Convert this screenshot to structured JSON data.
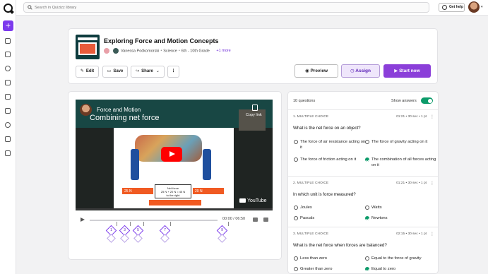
{
  "search": {
    "placeholder": "Search in Quizizz library"
  },
  "topbar": {
    "help_label": "Get help"
  },
  "quiz": {
    "title": "Exploring Force and Motion Concepts",
    "author": "Vanessa Podkomorski",
    "subject": "Science",
    "grade": "6th - 10th Grade",
    "more": "+1 more"
  },
  "actions": {
    "edit": "Edit",
    "save": "Save",
    "share": "Share",
    "more": "⋮",
    "preview": "Preview",
    "assign": "Assign",
    "start": "Start now"
  },
  "video": {
    "title": "Force and Motion",
    "subtitle": "Combining net force",
    "copy_link": "Copy link",
    "left_force": "25 N",
    "right_force": "20 N",
    "net_force_text": "Net force\n25 N + 20 N = 45 N\nto the right",
    "yt_label": "YouTube",
    "time": "00:00 / 06:50"
  },
  "video_markers": [
    "1",
    "3",
    "5",
    "7",
    "9"
  ],
  "panel": {
    "count": "10 questions",
    "show_answers": "Show answers",
    "show_answers_on": true
  },
  "questions": [
    {
      "type": "1. MULTIPLE CHOICE",
      "time": "01:21",
      "sec": "30 sec",
      "pts": "1 pt",
      "text": "What is the net force on an object?",
      "options": [
        {
          "label": "The force of air resistance acting on it",
          "correct": false
        },
        {
          "label": "The force of gravity acting on it",
          "correct": false
        },
        {
          "label": "The force of friction acting on it",
          "correct": false
        },
        {
          "label": "The combination of all forces acting on it",
          "correct": true
        }
      ]
    },
    {
      "type": "2. MULTIPLE CHOICE",
      "time": "01:21",
      "sec": "30 sec",
      "pts": "1 pt",
      "text": "In which unit is force measured?",
      "options": [
        {
          "label": "Joules",
          "correct": false
        },
        {
          "label": "Watts",
          "correct": false
        },
        {
          "label": "Pascals",
          "correct": false
        },
        {
          "label": "Newtons",
          "correct": true
        }
      ]
    },
    {
      "type": "3. MULTIPLE CHOICE",
      "time": "02:15",
      "sec": "30 sec",
      "pts": "1 pt",
      "text": "What is the net force when forces are balanced?",
      "options": [
        {
          "label": "Less than zero",
          "correct": false
        },
        {
          "label": "Equal to the force of gravity",
          "correct": false
        },
        {
          "label": "Greater than zero",
          "correct": false
        },
        {
          "label": "Equal to zero",
          "correct": true
        }
      ]
    }
  ]
}
